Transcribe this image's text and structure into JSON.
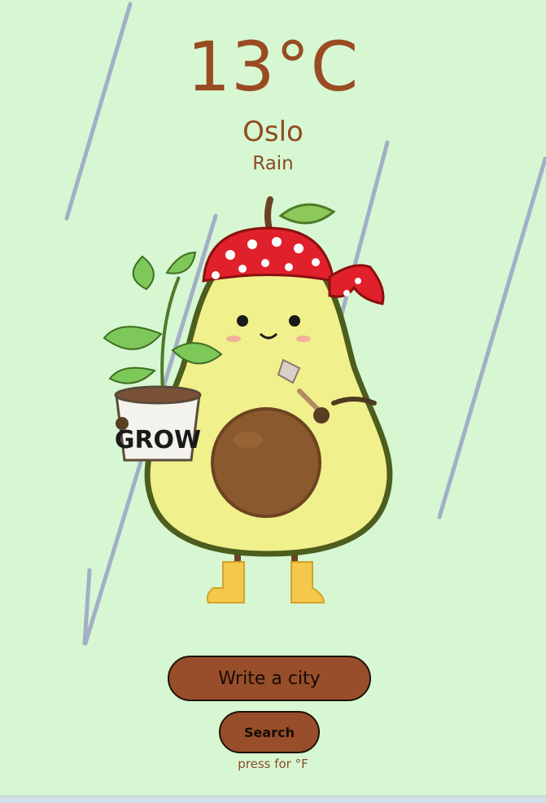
{
  "weather": {
    "temperature": "13°C",
    "city": "Oslo",
    "description": "Rain"
  },
  "illustration": {
    "pot_text": "GROW",
    "subject": "avocado-gardener-illustration"
  },
  "controls": {
    "city_placeholder": "Write a city",
    "search_label": "Search",
    "unit_toggle_label": "press for °F"
  },
  "colors": {
    "background": "#d6f7d2",
    "accent": "#984e2a",
    "text": "#8f4a24",
    "rain": "#9aa3c4"
  }
}
